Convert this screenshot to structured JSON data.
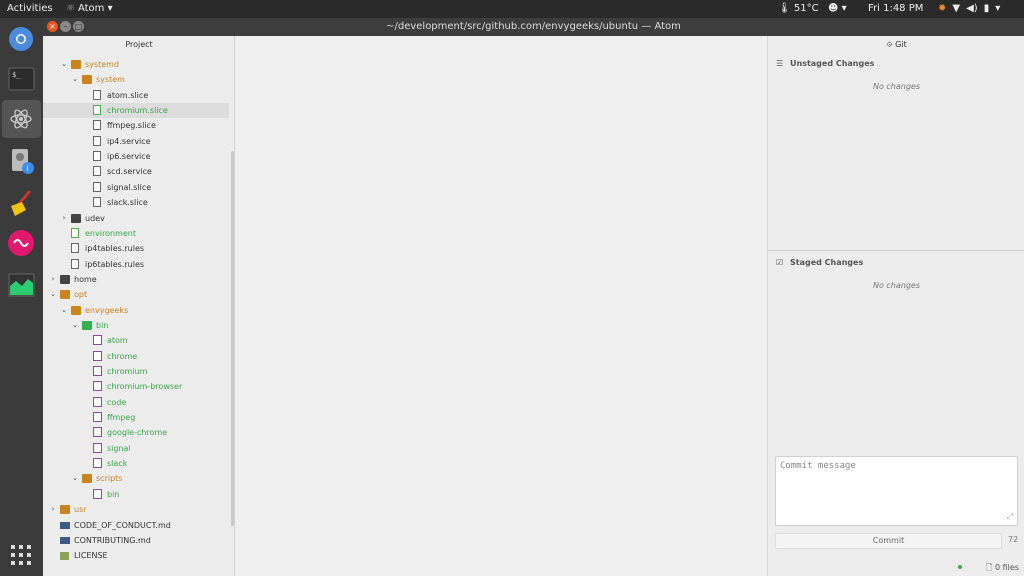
{
  "topbar": {
    "activities": "Activities",
    "app_name": "Atom",
    "temperature": "51°C",
    "clock": "Fri  1:48 PM"
  },
  "window": {
    "title": "~/development/src/github.com/envygeeks/ubuntu — Atom"
  },
  "tree": {
    "header": "Project",
    "rows": [
      {
        "label": "systemd",
        "kind": "folder",
        "open": true,
        "depth": 2,
        "color": "orange"
      },
      {
        "label": "system",
        "kind": "folder",
        "open": true,
        "depth": 3,
        "color": "orange"
      },
      {
        "label": "atom.slice",
        "kind": "file",
        "depth": 4,
        "color": "dark"
      },
      {
        "label": "chromium.slice",
        "kind": "file-git",
        "depth": 4,
        "color": "green",
        "selected": true
      },
      {
        "label": "ffmpeg.slice",
        "kind": "file",
        "depth": 4,
        "color": "dark"
      },
      {
        "label": "ip4.service",
        "kind": "file",
        "depth": 4,
        "color": "dark"
      },
      {
        "label": "ip6.service",
        "kind": "file",
        "depth": 4,
        "color": "dark"
      },
      {
        "label": "scd.service",
        "kind": "file",
        "depth": 4,
        "color": "dark"
      },
      {
        "label": "signal.slice",
        "kind": "file",
        "depth": 4,
        "color": "dark"
      },
      {
        "label": "slack.slice",
        "kind": "file",
        "depth": 4,
        "color": "dark"
      },
      {
        "label": "udev",
        "kind": "folder-dark",
        "open": false,
        "depth": 2,
        "color": "dark"
      },
      {
        "label": "environment",
        "kind": "file-git",
        "depth": 2,
        "color": "green"
      },
      {
        "label": "ip4tables.rules",
        "kind": "file",
        "depth": 2,
        "color": "dark"
      },
      {
        "label": "ip6tables.rules",
        "kind": "file",
        "depth": 2,
        "color": "dark"
      },
      {
        "label": "home",
        "kind": "folder-dark",
        "open": false,
        "depth": 1,
        "color": "dark"
      },
      {
        "label": "opt",
        "kind": "folder",
        "open": true,
        "depth": 1,
        "color": "orange"
      },
      {
        "label": "envygeeks",
        "kind": "folder",
        "open": true,
        "depth": 2,
        "color": "orange"
      },
      {
        "label": "bin",
        "kind": "folder-green",
        "open": true,
        "depth": 3,
        "color": "green"
      },
      {
        "label": "atom",
        "kind": "script",
        "depth": 4,
        "color": "green"
      },
      {
        "label": "chrome",
        "kind": "script",
        "depth": 4,
        "color": "green"
      },
      {
        "label": "chromium",
        "kind": "script",
        "depth": 4,
        "color": "green"
      },
      {
        "label": "chromium-browser",
        "kind": "script",
        "depth": 4,
        "color": "green"
      },
      {
        "label": "code",
        "kind": "script",
        "depth": 4,
        "color": "green"
      },
      {
        "label": "ffmpeg",
        "kind": "script",
        "depth": 4,
        "color": "green"
      },
      {
        "label": "google-chrome",
        "kind": "script",
        "depth": 4,
        "color": "green"
      },
      {
        "label": "signal",
        "kind": "script",
        "depth": 4,
        "color": "green"
      },
      {
        "label": "slack",
        "kind": "script",
        "depth": 4,
        "color": "green"
      },
      {
        "label": "scripts",
        "kind": "folder",
        "open": true,
        "depth": 3,
        "color": "orange"
      },
      {
        "label": "bin",
        "kind": "script",
        "depth": 4,
        "color": "green"
      },
      {
        "label": "usr",
        "kind": "folder",
        "open": false,
        "depth": 1,
        "color": "orange"
      },
      {
        "label": "CODE_OF_CONDUCT.md",
        "kind": "md",
        "depth": 1,
        "color": "dark"
      },
      {
        "label": "CONTRIBUTING.md",
        "kind": "md",
        "depth": 1,
        "color": "dark"
      },
      {
        "label": "LICENSE",
        "kind": "license",
        "depth": 1,
        "color": "dark"
      }
    ]
  },
  "git": {
    "header": "Git",
    "unstaged_title": "Unstaged Changes",
    "unstaged_empty": "No changes",
    "staged_title": "Staged Changes",
    "staged_empty": "No changes",
    "commit_placeholder": "Commit message",
    "commit_button": "Commit",
    "char_count": "72"
  },
  "status": {
    "files": "0 files"
  },
  "colors": {
    "orange_folder": "#c9841e",
    "git_green": "#3aa64a",
    "ubuntu_orange": "#e95420"
  }
}
